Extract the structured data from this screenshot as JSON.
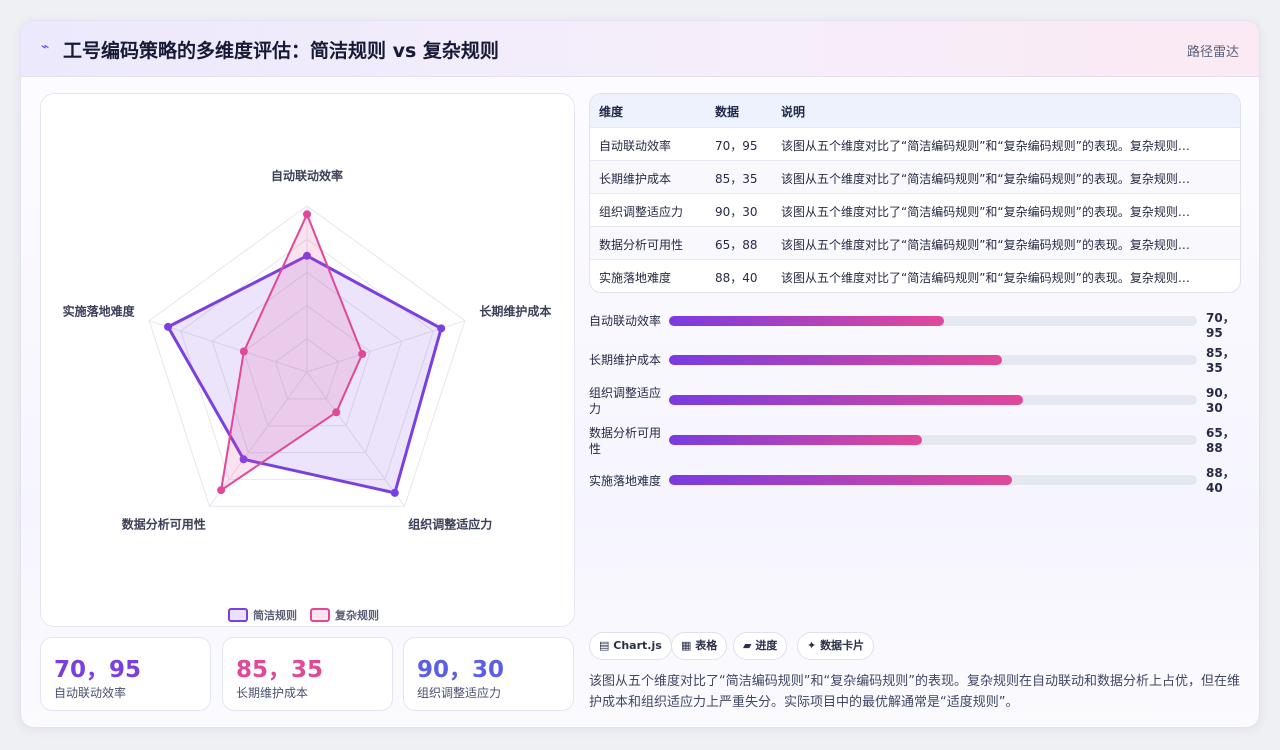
{
  "header": {
    "icon": "⌁",
    "title": "工号编码策略的多维度评估：简洁规则 vs 复杂规则",
    "link": "路径雷达"
  },
  "chart_data": {
    "type": "radar",
    "axes": [
      "自动联动效率",
      "长期维护成本",
      "组织调整适应力",
      "数据分析可用性",
      "实施落地难度"
    ],
    "series": [
      {
        "name": "简洁规则",
        "values": [
          70,
          85,
          90,
          65,
          88
        ],
        "color": "#7b3fe0"
      },
      {
        "name": "复杂规则",
        "values": [
          95,
          35,
          30,
          88,
          40
        ],
        "color": "#e0489a"
      }
    ],
    "range": [
      0,
      100
    ],
    "grid": true,
    "legend": "bottom"
  },
  "kpis": [
    {
      "value": "70，95",
      "label": "自动联动效率",
      "color": "#7b3fe0"
    },
    {
      "value": "85，35",
      "label": "长期维护成本",
      "color": "#e0489a"
    },
    {
      "value": "90，30",
      "label": "组织调整适应力",
      "color": "#5b5ee6"
    }
  ],
  "table": {
    "headers": [
      "维度",
      "数据",
      "说明"
    ],
    "rows": [
      {
        "dim": "自动联动效率",
        "data": "70，95",
        "note": "该图从五个维度对比了“简洁编码规则”和“复杂编码规则”的表现。复杂规则在自动联动和数据分析上占优，但在维护成本和组织适应力上严重失分。实际项目中的最优解通常是“适度规则”。"
      },
      {
        "dim": "长期维护成本",
        "data": "85，35",
        "note": "该图从五个维度对比了“简洁编码规则”和“复杂编码规则”的表现。复杂规则在自动联动和数据分析上占优，但在维护成本和组织适应力上严重失分。实际项目中的最优解通常是“适度规则”。"
      },
      {
        "dim": "组织调整适应力",
        "data": "90，30",
        "note": "该图从五个维度对比了“简洁编码规则”和“复杂编码规则”的表现。复杂规则在自动联动和数据分析上占优，但在维护成本和组织适应力上严重失分。实际项目中的最优解通常是“适度规则”。"
      },
      {
        "dim": "数据分析可用性",
        "data": "65，88",
        "note": "该图从五个维度对比了“简洁编码规则”和“复杂编码规则”的表现。复杂规则在自动联动和数据分析上占优，但在维护成本和组织适应力上严重失分。实际项目中的最优解通常是“适度规则”。"
      },
      {
        "dim": "实施落地难度",
        "data": "88，40",
        "note": "该图从五个维度对比了“简洁编码规则”和“复杂编码规则”的表现。复杂规则在自动联动和数据分析上占优，但在维护成本和组织适应力上严重失分。实际项目中的最优解通常是“适度规则”。"
      }
    ]
  },
  "bars": [
    {
      "label": "自动联动效率",
      "value": "70，95",
      "fill_percent": 52
    },
    {
      "label": "长期维护成本",
      "value": "85，35",
      "fill_percent": 63
    },
    {
      "label": "组织调整适应力",
      "value": "90，30",
      "fill_percent": 67
    },
    {
      "label": "数据分析可用性",
      "value": "65，88",
      "fill_percent": 48
    },
    {
      "label": "实施落地难度",
      "value": "88，40",
      "fill_percent": 65
    }
  ],
  "chips": [
    {
      "icon": "▤",
      "label": "Chart.js"
    },
    {
      "icon": "▦",
      "label": "表格"
    },
    {
      "icon": "▰",
      "label": "进度"
    },
    {
      "icon": "✦",
      "label": "数据卡片"
    }
  ],
  "description": "该图从五个维度对比了“简洁编码规则”和“复杂编码规则”的表现。复杂规则在自动联动和数据分析上占优，但在维护成本和组织适应力上严重失分。实际项目中的最优解通常是“适度规则”。"
}
